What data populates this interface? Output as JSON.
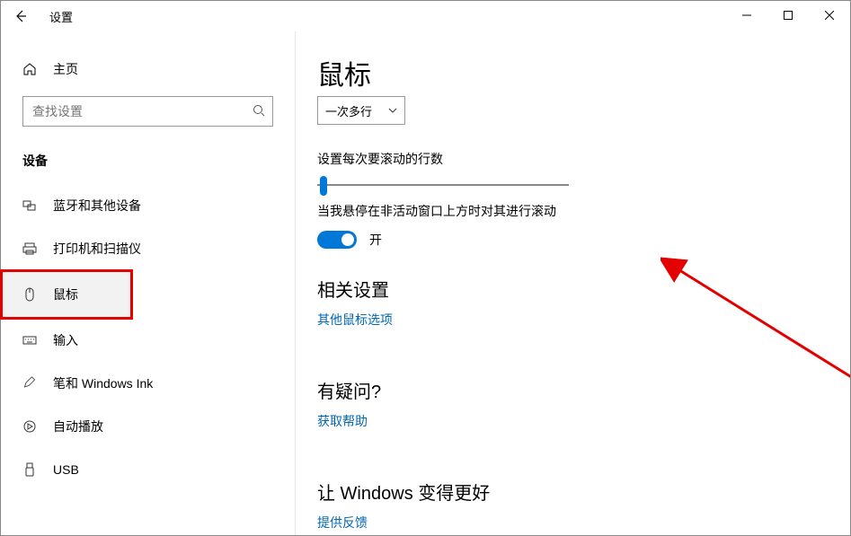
{
  "window": {
    "title": "设置"
  },
  "sidebar": {
    "home_label": "主页",
    "search_placeholder": "查找设置",
    "category": "设备",
    "items": [
      {
        "label": "蓝牙和其他设备"
      },
      {
        "label": "打印机和扫描仪"
      },
      {
        "label": "鼠标"
      },
      {
        "label": "输入"
      },
      {
        "label": "笔和 Windows Ink"
      },
      {
        "label": "自动播放"
      },
      {
        "label": "USB"
      }
    ]
  },
  "main": {
    "title": "鼠标",
    "scroll_mode": "一次多行",
    "lines_label": "设置每次要滚动的行数",
    "hover_scroll_label": "当我悬停在非活动窗口上方时对其进行滚动",
    "toggle_state": "开",
    "related_header": "相关设置",
    "related_link": "其他鼠标选项",
    "question_header": "有疑问?",
    "help_link": "获取帮助",
    "feedback_header": "让 Windows 变得更好",
    "feedback_link": "提供反馈"
  }
}
